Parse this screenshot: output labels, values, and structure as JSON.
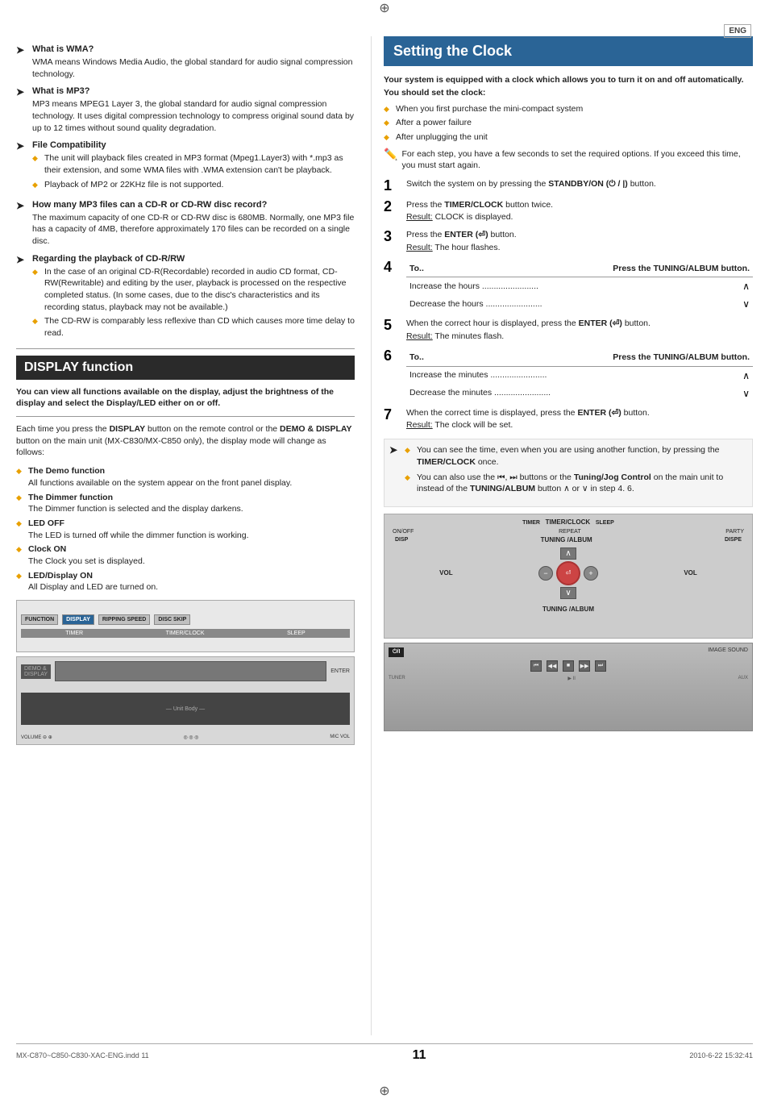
{
  "page": {
    "number": "11",
    "footer_left": "MX-C870~C850-C830-XAC-ENG.indd   11",
    "footer_right": "2010-6-22   15:32:41",
    "eng_badge": "ENG"
  },
  "left_col": {
    "sections": [
      {
        "id": "wma",
        "title": "What is WMA?",
        "body": "WMA means Windows Media Audio, the global standard for audio signal compression technology."
      },
      {
        "id": "mp3",
        "title": "What is MP3?",
        "body": "MP3 means MPEG1 Layer 3, the global standard for audio signal compression technology. It uses digital compression technology to compress original sound data by up to 12 times without sound quality degradation."
      },
      {
        "id": "file_compat",
        "title": "File Compatibility",
        "bullets": [
          "The unit will playback files created in MP3 format (Mpeg1.Layer3) with *.mp3 as their extension, and some WMA files with .WMA extension can't be playback.",
          "Playback of MP2 or 22KHz file is not supported."
        ]
      },
      {
        "id": "mp3_capacity",
        "title": "How many MP3 files can a CD-R or CD-RW disc record?",
        "body": "The maximum capacity of one CD-R or CD-RW disc is 680MB. Normally, one MP3 file has a capacity of 4MB, therefore approximately 170 files can be recorded on a single disc."
      },
      {
        "id": "cdrw",
        "title": "Regarding the playback of CD-R/RW",
        "bullets": [
          "In the case of an original CD-R(Recordable) recorded in audio CD format, CD-RW(Rewritable) and editing by the user, playback is processed on the respective completed status. (In some cases, due to the disc's characteristics and its recording status, playback may not be available.)",
          "The CD-RW is comparably less reflexive than CD which causes more time delay to read."
        ]
      }
    ],
    "display_function": {
      "header": "DISPLAY function",
      "intro": "You can view all functions available on the display, adjust the brightness of the display and select the Display/LED either on or off.",
      "body_intro": "Each time you press the DISPLAY button on the remote control or the DEMO & DISPLAY button on the main unit (MX-C830/MX-C850 only), the display mode will change as follows:",
      "items": [
        {
          "title": "The Demo function",
          "text": "All functions available on the system appear on the front panel display."
        },
        {
          "title": "The Dimmer function",
          "text": "The Dimmer function is selected and the display darkens."
        },
        {
          "title": "LED OFF",
          "text": "The LED is turned off while the dimmer function is working."
        },
        {
          "title": "Clock ON",
          "text": "The Clock you set is displayed."
        },
        {
          "title": "LED/Display ON",
          "text": "All Display and LED are turned on."
        }
      ]
    },
    "images": {
      "top_labels": [
        "FUNCTION",
        "DISPLAY",
        "RIPPING SPEED",
        "DISC SKIP"
      ],
      "bottom_labels": [
        "TIMER",
        "TIMER/CLOCK",
        "SLEEP"
      ],
      "highlighted_label": "DISPLAY"
    }
  },
  "right_col": {
    "header": "Setting the Clock",
    "intro_bold": "Your system is equipped with a clock which allows you to turn it on and off automatically.",
    "set_clock_label": "You should set the clock:",
    "set_clock_bullets": [
      "When you first purchase the mini-compact system",
      "After a power failure",
      "After unplugging the unit"
    ],
    "note": "For each step, you have a few seconds to set the required options. If you exceed this time, you must start again.",
    "steps": [
      {
        "num": "1",
        "text": "Switch the system on by pressing the STANDBY/ON (⏻ / |) button."
      },
      {
        "num": "2",
        "text": "Press the TIMER/CLOCK button twice.",
        "result": "CLOCK is displayed."
      },
      {
        "num": "3",
        "text": "Press the ENTER (⏎) button.",
        "result": "The hour flashes."
      },
      {
        "num": "4",
        "label": "To..",
        "press_label": "Press the TUNING/ALBUM button.",
        "sub_items": [
          {
            "text": "Increase the hours ........................",
            "arrow": "up"
          },
          {
            "text": "Decrease the hours ........................",
            "arrow": "down"
          }
        ]
      },
      {
        "num": "5",
        "text": "When the correct hour is displayed, press the ENTER (⏎) button.",
        "result": "The minutes flash."
      },
      {
        "num": "6",
        "label": "To..",
        "press_label": "Press the TUNING/ALBUM button.",
        "sub_items": [
          {
            "text": "Increase the minutes ........................",
            "arrow": "up"
          },
          {
            "text": "Decrease the minutes ........................",
            "arrow": "down"
          }
        ]
      },
      {
        "num": "7",
        "text": "When the correct time is displayed, press the ENTER (⏎) button.",
        "result": "The clock will be set."
      }
    ],
    "extra_notes": [
      "You can see the time, even when you are using another function, by pressing the TIMER/CLOCK once.",
      "You can also use the ⏮, ⏭ buttons or the Tuning/Jog Control on the main unit to instead of the TUNING/ALBUM button ∧ or ∨ in step 4. 6."
    ],
    "images": {
      "remote_labels": {
        "timer": "TIMER",
        "timer_clock": "TIMER/CLOCK",
        "sleep": "SLEEP",
        "on_off": "ON/OFF",
        "tuning_album": "TUNING /ALBUM",
        "vol": "VOL",
        "standby": "⏻/I"
      }
    }
  }
}
